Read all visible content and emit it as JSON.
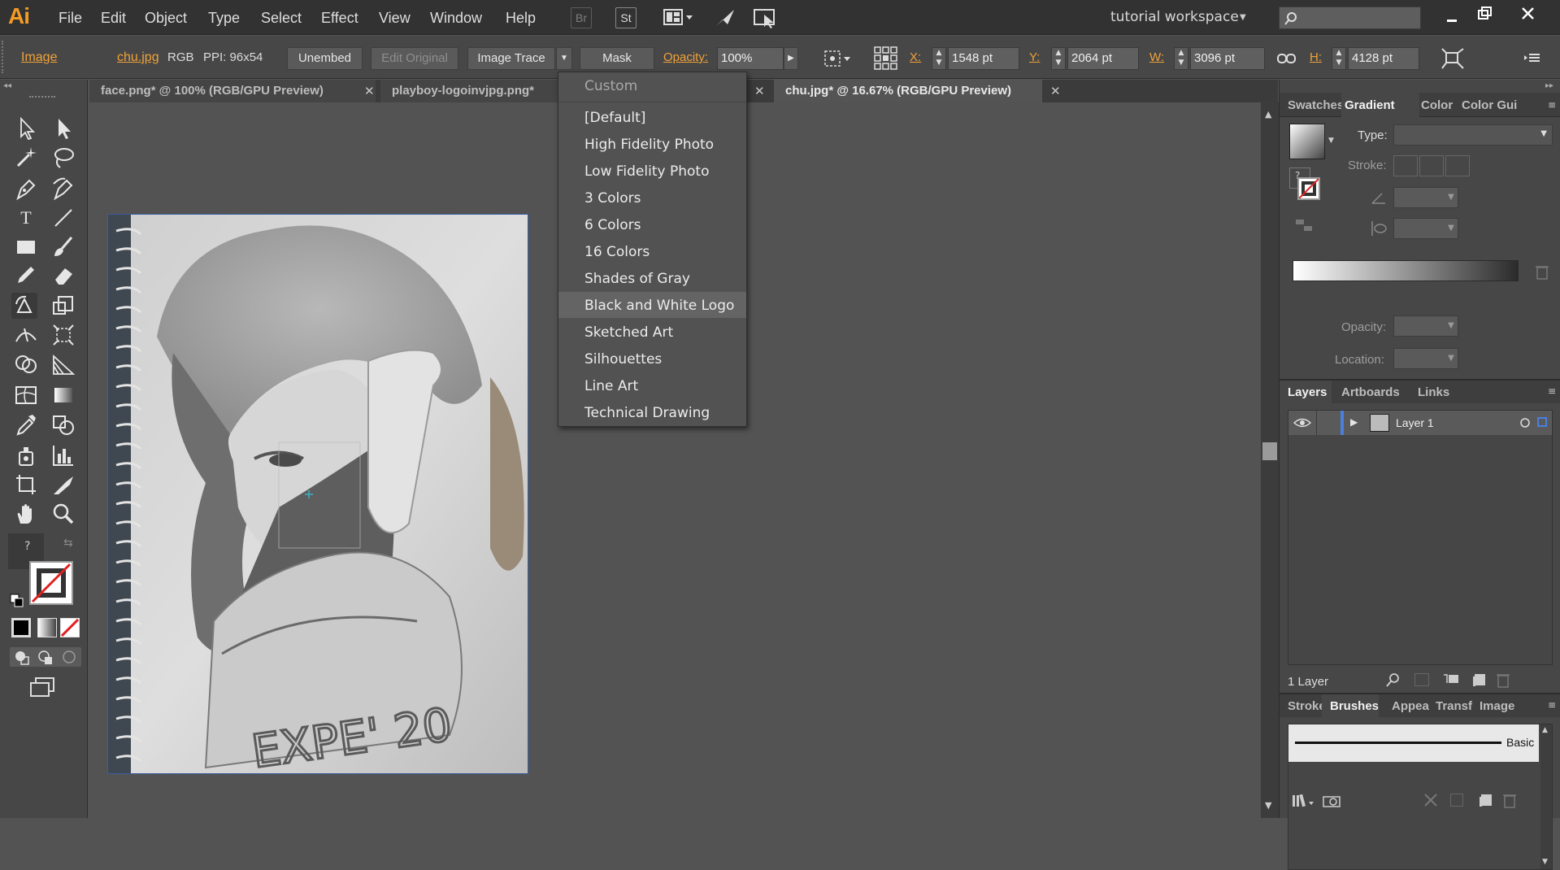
{
  "app": {
    "logo": "Ai"
  },
  "menu": [
    "File",
    "Edit",
    "Object",
    "Type",
    "Select",
    "Effect",
    "View",
    "Window",
    "Help"
  ],
  "menubar_buttons": {
    "bridge": "Br",
    "stock": "St"
  },
  "workspace": {
    "label": "tutorial workspace",
    "search_placeholder": ""
  },
  "control": {
    "object_type": "Image",
    "file_name": "chu.jpg",
    "color_mode": "RGB",
    "ppi": "PPI: 96x54",
    "unembed": "Unembed",
    "edit_original": "Edit Original",
    "image_trace": "Image Trace",
    "mask": "Mask",
    "opacity_label": "Opacity:",
    "opacity_value": "100%",
    "x_label": "X:",
    "x_value": "1548 pt",
    "y_label": "Y:",
    "y_value": "2064 pt",
    "w_label": "W:",
    "w_value": "3096 pt",
    "h_label": "H:",
    "h_value": "4128 pt"
  },
  "tabs": [
    {
      "label": "face.png* @ 100% (RGB/GPU Preview)"
    },
    {
      "label": "playboy-logoinvjpg.png*"
    },
    {
      "label": "chu.jpg* @ 16.67% (RGB/GPU Preview)"
    }
  ],
  "trace_presets": {
    "header": "Custom",
    "items": [
      "[Default]",
      "High Fidelity Photo",
      "Low Fidelity Photo",
      "3 Colors",
      "6 Colors",
      "16 Colors",
      "Shades of Gray",
      "Black and White Logo",
      "Sketched Art",
      "Silhouettes",
      "Line Art",
      "Technical Drawing"
    ],
    "highlighted": "Black and White Logo"
  },
  "gradient_panel": {
    "tabs": [
      "Swatches",
      "Gradient",
      "Color",
      "Color Gui"
    ],
    "active": "Gradient",
    "type_label": "Type:",
    "stroke_label": "Stroke:",
    "opacity_label": "Opacity:",
    "location_label": "Location:"
  },
  "layers_panel": {
    "tabs": [
      "Layers",
      "Artboards",
      "Links"
    ],
    "layer_name": "Layer 1",
    "count": "1 Layer"
  },
  "brushes_panel": {
    "tabs": [
      "Stroke",
      "Brushes",
      "Appea",
      "Transf",
      "Image"
    ],
    "active": "Brushes",
    "brush": "Basic"
  },
  "colors": {
    "accent": "#f29b25",
    "selection": "#3a5ea0",
    "layer_color": "#4a7fe0"
  }
}
